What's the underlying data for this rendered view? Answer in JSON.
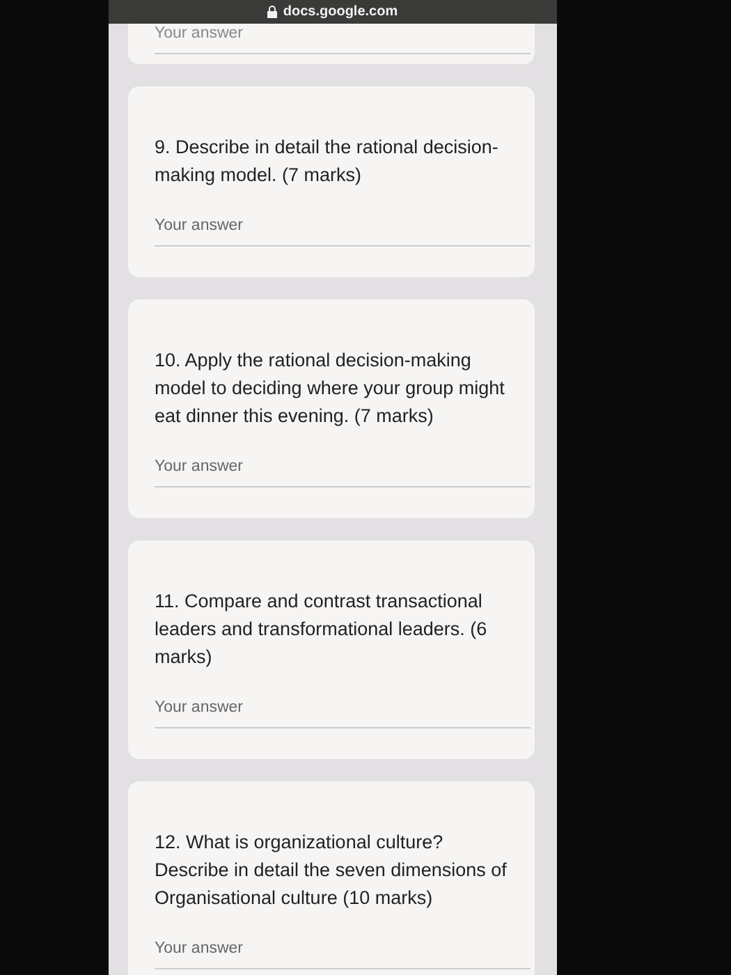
{
  "browser": {
    "url": "docs.google.com"
  },
  "partial_card": {
    "placeholder": "Your answer"
  },
  "questions": [
    {
      "text": "9. Describe in detail the rational decision-making model. (7 marks)",
      "placeholder": "Your answer"
    },
    {
      "text": "10. Apply the rational decision-making model to deciding where your group might eat dinner this evening. (7 marks)",
      "placeholder": "Your answer"
    },
    {
      "text": "11. Compare and contrast transactional leaders and transformational leaders. (6 marks)",
      "placeholder": "Your answer"
    },
    {
      "text": "12. What is organizational culture? Describe in detail the seven dimensions of Organisational culture (10 marks)",
      "placeholder": "Your answer"
    }
  ]
}
